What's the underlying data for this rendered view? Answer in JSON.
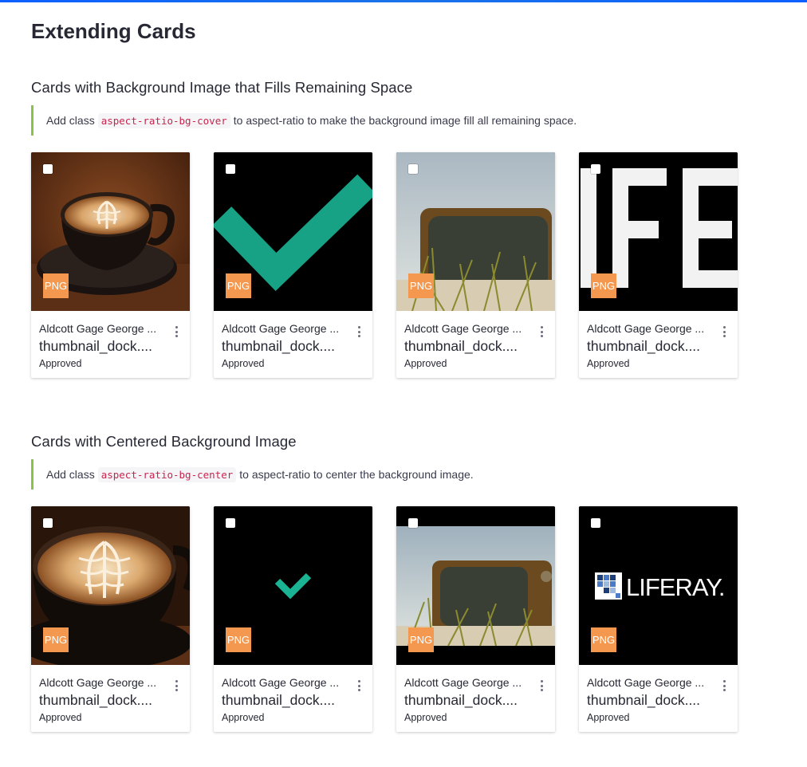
{
  "page_title": "Extending Cards",
  "sections": [
    {
      "title": "Cards with Background Image that Fills Remaining Space",
      "note_prefix": "Add class",
      "note_code": "aspect-ratio-bg-cover",
      "note_suffix": "to aspect-ratio to make the background image fill all remaining space.",
      "cards": [
        {
          "image": "latte-cover",
          "badge": "PNG",
          "author": "Aldcott Gage George ...",
          "name": "thumbnail_dock....",
          "status": "Approved"
        },
        {
          "image": "checkmark-cover",
          "badge": "PNG",
          "author": "Aldcott Gage George ...",
          "name": "thumbnail_dock....",
          "status": "Approved"
        },
        {
          "image": "tv-cover",
          "badge": "PNG",
          "author": "Aldcott Gage George ...",
          "name": "thumbnail_dock....",
          "status": "Approved"
        },
        {
          "image": "liferay-cover",
          "badge": "PNG",
          "author": "Aldcott Gage George ...",
          "name": "thumbnail_dock....",
          "status": "Approved"
        }
      ]
    },
    {
      "title": "Cards with Centered Background Image",
      "note_prefix": "Add class",
      "note_code": "aspect-ratio-bg-center",
      "note_suffix": "to aspect-ratio to center the background image.",
      "cards": [
        {
          "image": "latte-center",
          "badge": "PNG",
          "author": "Aldcott Gage George ...",
          "name": "thumbnail_dock....",
          "status": "Approved"
        },
        {
          "image": "checkmark-center",
          "badge": "PNG",
          "author": "Aldcott Gage George ...",
          "name": "thumbnail_dock....",
          "status": "Approved"
        },
        {
          "image": "tv-center",
          "badge": "PNG",
          "author": "Aldcott Gage George ...",
          "name": "thumbnail_dock....",
          "status": "Approved"
        },
        {
          "image": "liferay-center",
          "badge": "PNG",
          "author": "Aldcott Gage George ...",
          "name": "thumbnail_dock....",
          "status": "Approved",
          "logo_text": "LIFERAY."
        }
      ]
    }
  ],
  "colors": {
    "accent_border": "#8bc34a",
    "badge": "#f5984f",
    "check": "#1ab394",
    "code": "#c7254e"
  }
}
